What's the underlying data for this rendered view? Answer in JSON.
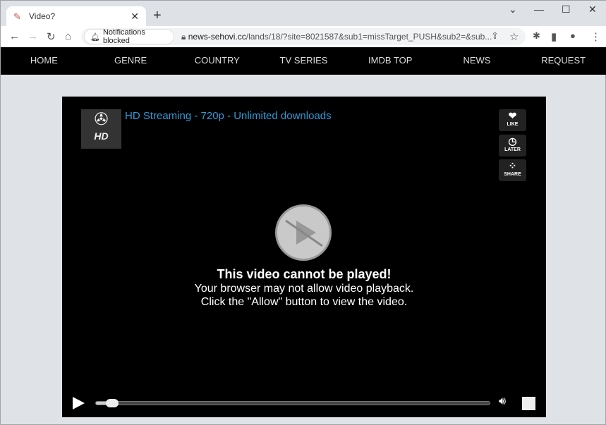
{
  "browser": {
    "tab_title": "Video?",
    "notifications": "Notifications blocked",
    "url_host": "news-sehovi.cc",
    "url_path": "/lands/18/?site=8021587&sub1=missTarget_PUSH&sub2=&sub..."
  },
  "nav": {
    "items": [
      "HOME",
      "GENRE",
      "COUNTRY",
      "TV SERIES",
      "IMDB TOP",
      "NEWS",
      "REQUEST"
    ]
  },
  "player": {
    "logo_text": "HD",
    "title": "HD Streaming - 720p - Unlimited downloads",
    "like": "LIKE",
    "later": "LATER",
    "share": "SHARE",
    "heading": "This video cannot be played!",
    "line1": "Your browser may not allow video playback.",
    "line2": "Click the \"Allow\" button to view the video.",
    "progress_percent": 3,
    "title_color": "#2e9bd6"
  }
}
